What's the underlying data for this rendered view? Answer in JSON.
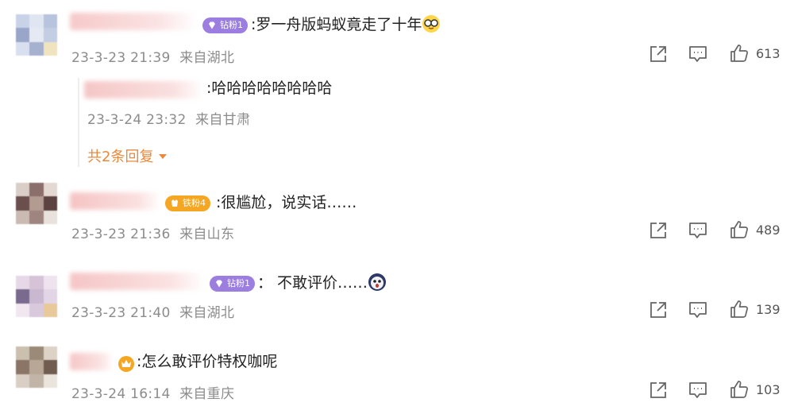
{
  "comments": [
    {
      "badge": "钻粉1",
      "text": ":罗一舟版蚂蚁竟走了十年",
      "emoji": "glasses-emoji",
      "time": "23-3-23 21:39",
      "location": "来自湖北",
      "likes": "613",
      "replies": [
        {
          "text": ":哈哈哈哈哈哈哈哈",
          "time": "23-3-24 23:32",
          "location": "来自甘肃"
        }
      ],
      "more_replies": "共2条回复"
    },
    {
      "badge": "铁粉4",
      "text": ":很尴尬，说实话……",
      "time": "23-3-23 21:36",
      "location": "来自山东",
      "likes": "489"
    },
    {
      "badge": "钻粉1",
      "text": "： 不敢评价……",
      "emoji": "shocked-emoji",
      "time": "23-3-23 21:40",
      "location": "来自湖北",
      "likes": "139"
    },
    {
      "text": ":怎么敢评价特权咖呢",
      "time": "23-3-24 16:14",
      "location": "来自重庆",
      "likes": "103"
    }
  ],
  "colors": {
    "diamond_badge": "#9b7ee0",
    "iron_badge": "#f5a623",
    "meta_text": "#8c8c8c",
    "reply_link": "#e8893d"
  },
  "icons": [
    "share-icon",
    "comment-icon",
    "like-icon",
    "chevron-down-icon"
  ]
}
